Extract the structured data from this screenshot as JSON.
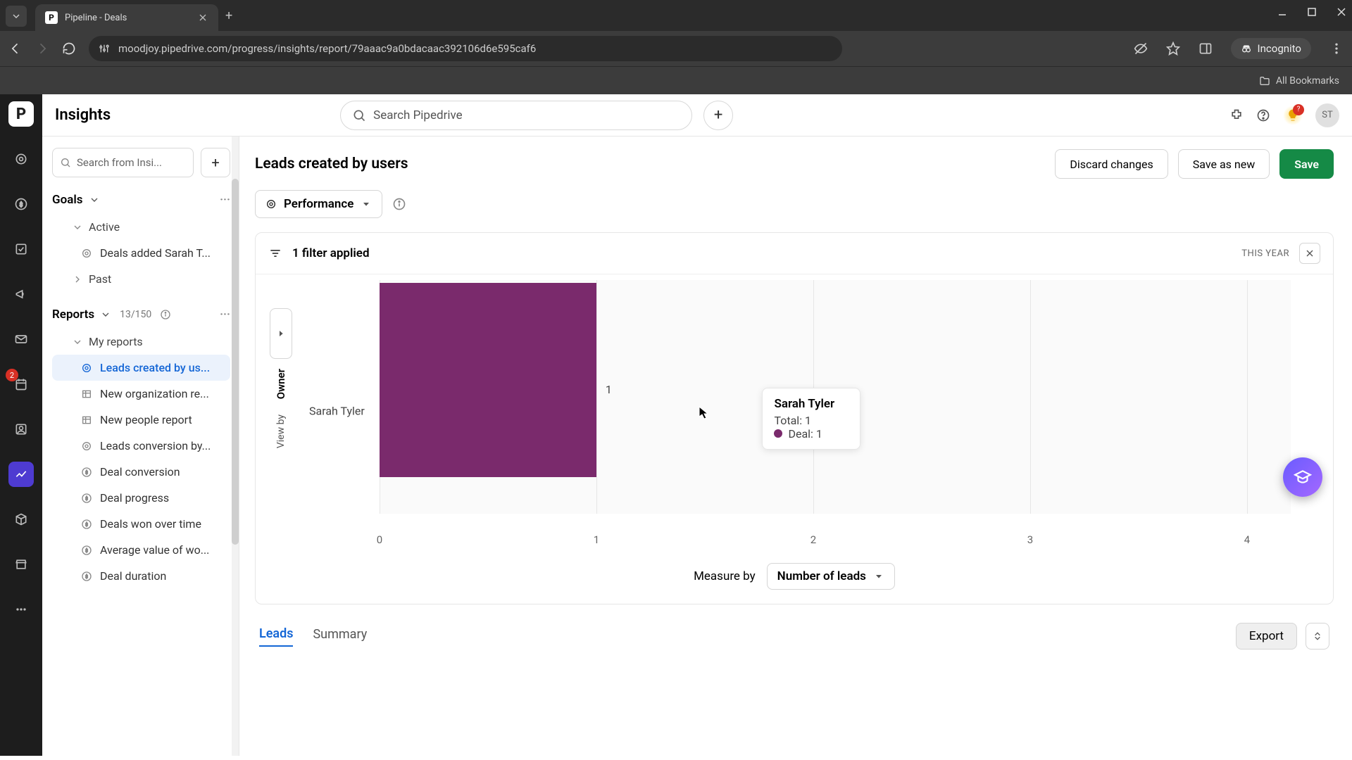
{
  "browser": {
    "tab_title": "Pipeline - Deals",
    "favicon_letter": "P",
    "url": "moodjoy.pipedrive.com/progress/insights/report/79aaac9a0bdacaac392106d6e595caf6",
    "incognito_label": "Incognito",
    "bookmarks_label": "All Bookmarks"
  },
  "rail": {
    "badge_count": "2"
  },
  "topbar": {
    "title": "Insights",
    "search_placeholder": "Search Pipedrive",
    "lamp_badge": "?",
    "avatar_initials": "ST"
  },
  "sidebar": {
    "search_placeholder": "Search from Insi...",
    "goals_label": "Goals",
    "active_label": "Active",
    "goal_item": "Deals added Sarah T...",
    "past_label": "Past",
    "reports_label": "Reports",
    "reports_count": "13/150",
    "my_reports_label": "My reports",
    "reports": [
      "Leads created by us...",
      "New organization re...",
      "New people report",
      "Leads conversion by...",
      "Deal conversion",
      "Deal progress",
      "Deals won over time",
      "Average value of wo...",
      "Deal duration"
    ]
  },
  "report": {
    "title": "Leads created by users",
    "discard_label": "Discard changes",
    "save_as_new_label": "Save as new",
    "save_label": "Save",
    "performance_label": "Performance",
    "filter_applied": "1 filter applied",
    "filter_tag": "THIS YEAR",
    "viewby_primary": "Owner",
    "viewby_secondary": "View by",
    "measure_by_label": "Measure by",
    "measure_select": "Number of leads",
    "tabs": {
      "leads": "Leads",
      "summary": "Summary"
    },
    "export_label": "Export"
  },
  "tooltip": {
    "title": "Sarah Tyler",
    "total_label": "Total: 1",
    "series_label": "Deal: 1"
  },
  "chart_data": {
    "type": "bar",
    "orientation": "horizontal",
    "categories": [
      "Sarah Tyler"
    ],
    "series": [
      {
        "name": "Deal",
        "values": [
          1
        ],
        "color": "#7a2a6c"
      }
    ],
    "bar_value_labels": [
      "1"
    ],
    "xlabel": "",
    "ylabel": "",
    "xlim": [
      0,
      4.2
    ],
    "x_ticks": [
      0,
      1,
      2,
      3,
      4
    ],
    "grid": {
      "vertical": true,
      "horizontal": false
    },
    "title": ""
  }
}
